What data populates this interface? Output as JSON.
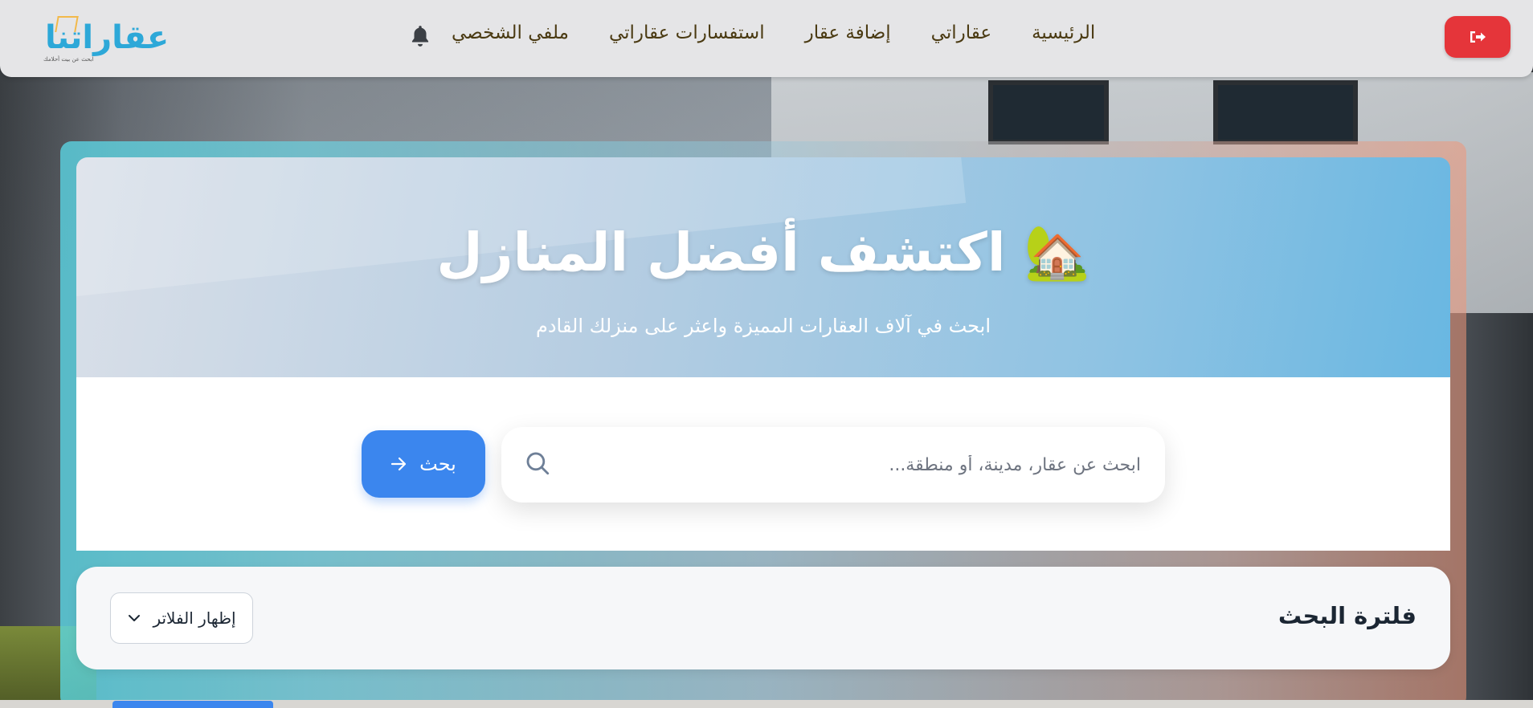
{
  "brand": {
    "logo_text": "عقاراتنا",
    "logo_tagline": "ابحث عن بيت أحلامك",
    "accent_color": "#2da8d8"
  },
  "navbar": {
    "links": [
      {
        "label": "ملفي الشخصي"
      },
      {
        "label": "استفسارات عقاراتي"
      },
      {
        "label": "إضافة عقار"
      },
      {
        "label": "عقاراتي"
      },
      {
        "label": "الرئيسية"
      }
    ],
    "bell_icon": "bell-icon",
    "logout_icon": "sign-out-icon",
    "logout_color": "#e5353a"
  },
  "hero": {
    "title": "اكتشف أفضل المنازل",
    "emoji": "🏡",
    "subtitle": "ابحث في آلاف العقارات المميزة واعثر على منزلك القادم"
  },
  "search": {
    "placeholder": "ابحث عن عقار، مدينة، أو منطقة...",
    "value": "",
    "button_label": "بحث",
    "button_color": "#3b86ee"
  },
  "filters": {
    "title": "فلترة البحث",
    "toggle_label": "إظهار الفلاتر"
  }
}
